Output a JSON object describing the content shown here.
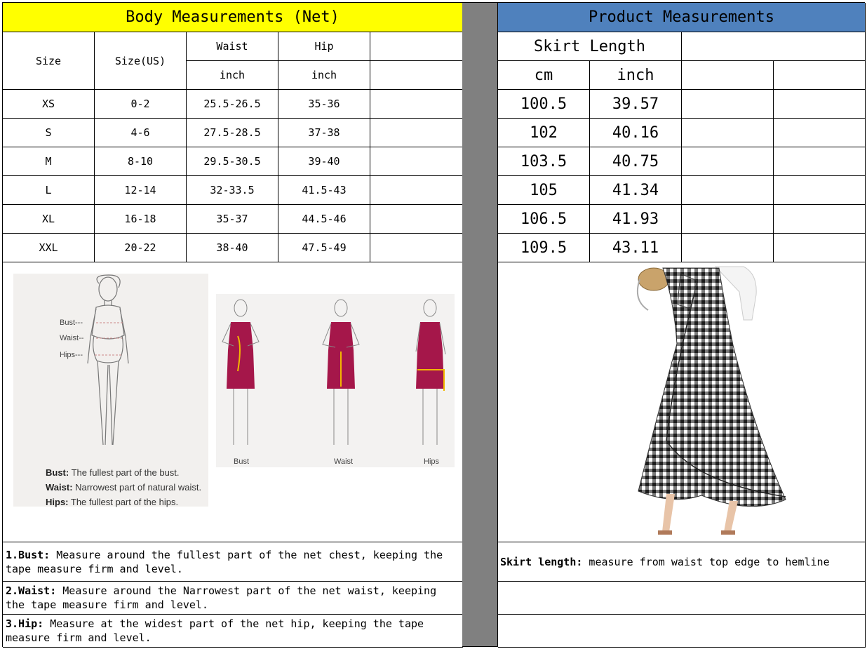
{
  "body_table": {
    "title": "Body Measurements (Net)",
    "headers": {
      "size": "Size",
      "size_us": "Size(US)",
      "waist": "Waist",
      "hip": "Hip",
      "waist_unit": "inch",
      "hip_unit": "inch"
    },
    "rows": [
      {
        "size": "XS",
        "us": "0-2",
        "waist": "25.5-26.5",
        "hip": "35-36"
      },
      {
        "size": "S",
        "us": "4-6",
        "waist": "27.5-28.5",
        "hip": "37-38"
      },
      {
        "size": "M",
        "us": "8-10",
        "waist": "29.5-30.5",
        "hip": "39-40"
      },
      {
        "size": "L",
        "us": "12-14",
        "waist": "32-33.5",
        "hip": "41.5-43"
      },
      {
        "size": "XL",
        "us": "16-18",
        "waist": "35-37",
        "hip": "44.5-46"
      },
      {
        "size": "XXL",
        "us": "20-22",
        "waist": "38-40",
        "hip": "47.5-49"
      }
    ]
  },
  "product_table": {
    "title": "Product Measurements",
    "skirt_length": "Skirt Length",
    "unit_cm": "cm",
    "unit_inch": "inch",
    "rows": [
      {
        "cm": "100.5",
        "inch": "39.57"
      },
      {
        "cm": "102",
        "inch": "40.16"
      },
      {
        "cm": "103.5",
        "inch": "40.75"
      },
      {
        "cm": "105",
        "inch": "41.34"
      },
      {
        "cm": "106.5",
        "inch": "41.93"
      },
      {
        "cm": "109.5",
        "inch": "43.11"
      }
    ]
  },
  "figure": {
    "body_marks": {
      "bust": "Bust---",
      "waist": "Waist--",
      "hips": "Hips---"
    },
    "legend": [
      {
        "term": "Bust:",
        "text": "The fullest part of the bust."
      },
      {
        "term": "Waist:",
        "text": "Narrowest part of natural waist."
      },
      {
        "term": "Hips:",
        "text": "The fullest part of the hips."
      }
    ],
    "dress_labels": [
      "Bust",
      "Waist",
      "Hips"
    ]
  },
  "notes": [
    {
      "term": "1.Bust:",
      "line1": " Measure around the fullest part of the net chest, keeping the",
      "line2": "tape  measure firm and level."
    },
    {
      "term": "2.Waist:",
      "line1": " Measure around the Narrowest part of the net waist, keeping",
      "line2": "the tape  measure firm and level."
    },
    {
      "term": "3.Hip:",
      "line1": " Measure at the widest part of the net hip, keeping the tape",
      "line2": "measure firm and level."
    }
  ],
  "product_note": {
    "term": "Skirt length:",
    "text": " measure from waist top edge to hemline"
  },
  "colors": {
    "yellow_header": "#ffff00",
    "blue_header": "#4f81bd",
    "divider": "#808080",
    "dress": "#a5174a",
    "tape": "#f2b700"
  }
}
